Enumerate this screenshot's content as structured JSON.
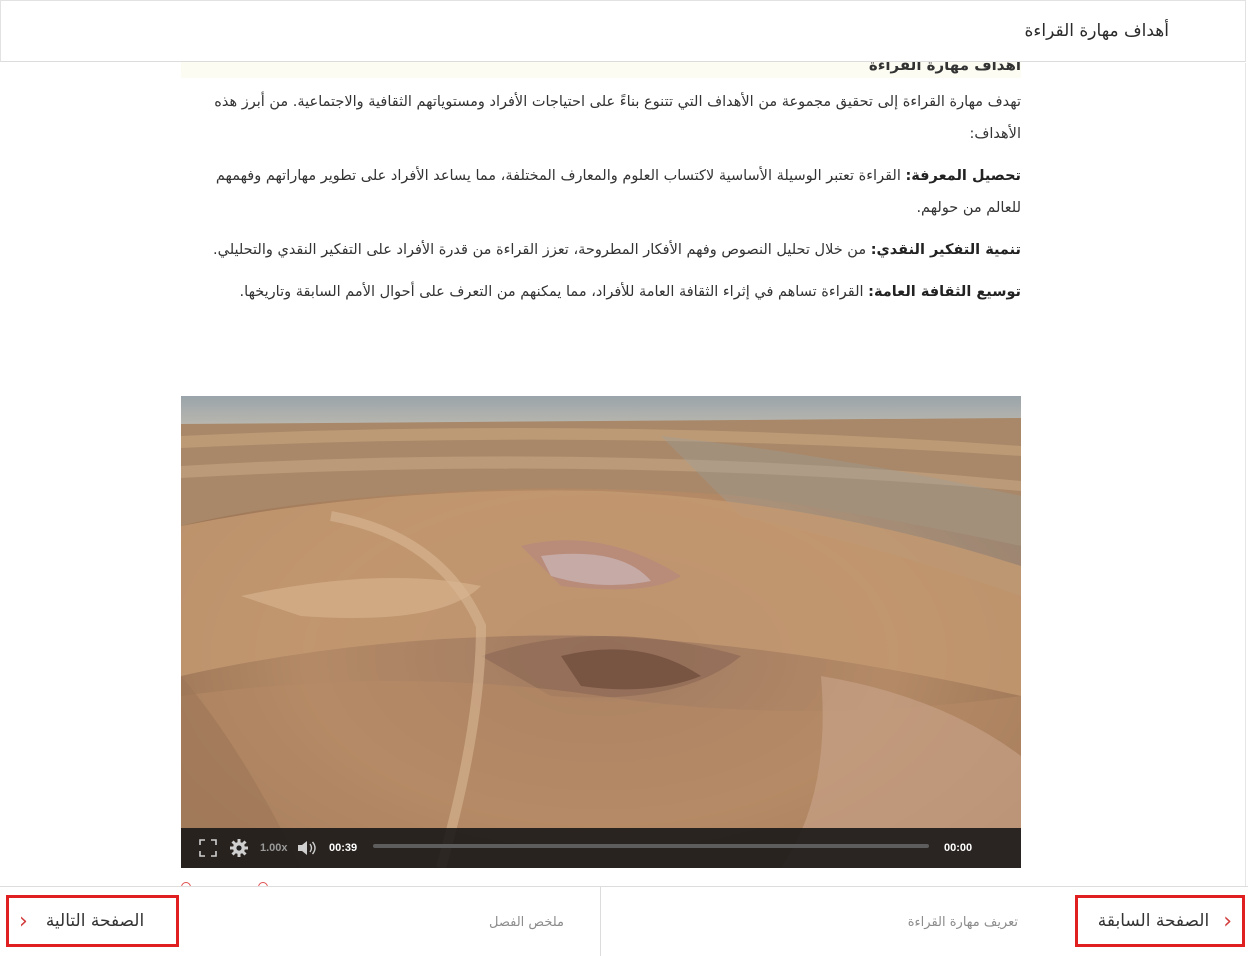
{
  "header": {
    "title": "أهداف مهارة القراءة"
  },
  "content": {
    "section_heading": "أهداف مهارة القراءة",
    "intro": "تهدف مهارة القراءة إلى تحقيق مجموعة من الأهداف التي تتنوع بناءً على احتياجات الأفراد ومستوياتهم الثقافية والاجتماعية. من أبرز هذه الأهداف:",
    "items": [
      {
        "title": "تحصيل المعرفة:",
        "text": " القراءة تعتبر الوسيلة الأساسية لاكتساب العلوم والمعارف المختلفة، مما يساعد الأفراد على تطوير مهاراتهم وفهمهم للعالم من حولهم."
      },
      {
        "title": "تنمية التفكير النقدي:",
        "text": " من خلال تحليل النصوص وفهم الأفكار المطروحة، تعزز القراءة من قدرة الأفراد على التفكير النقدي والتحليلي."
      },
      {
        "title": "توسيع الثقافة العامة:",
        "text": " القراءة تساهم في إثراء الثقافة العامة للأفراد، مما يمكنهم من التعرف على أحوال الأمم السابقة وتاريخها."
      }
    ]
  },
  "video": {
    "speed": "1.00x",
    "current_time": "00:39",
    "duration": "00:00",
    "progress": 0,
    "icons": {
      "fullscreen": "fullscreen-icon",
      "settings": "gear-icon",
      "volume": "volume-icon"
    }
  },
  "footer": {
    "prev": {
      "label": "الصفحة السابقة",
      "sublabel": "تعريف مهارة القراءة"
    },
    "next": {
      "label": "الصفحة التالية",
      "sublabel": "ملخص الفصل"
    }
  },
  "colors": {
    "highlight_border": "#e02020",
    "chevron": "#d23c3c"
  }
}
